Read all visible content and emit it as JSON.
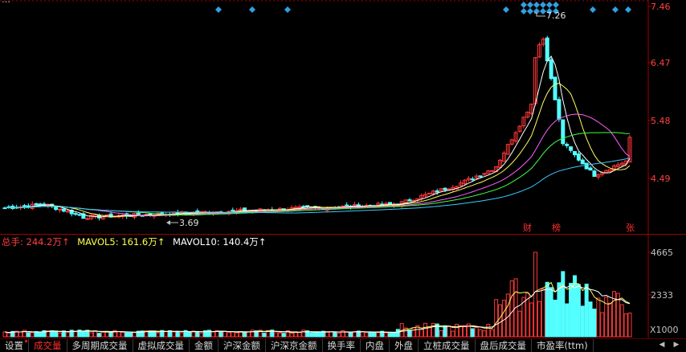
{
  "window": {
    "title_partial": "…"
  },
  "price_axis": {
    "labels": [
      "7.46",
      "6.47",
      "5.48",
      "4.49"
    ]
  },
  "volume_axis": {
    "labels": [
      "4665",
      "2333",
      "X1000"
    ]
  },
  "annotations": {
    "high_label": "7.26",
    "low_label": "3.69",
    "markers": [
      "财",
      "榜",
      "张"
    ]
  },
  "volume_header": {
    "total": "总手: 244.2万↑",
    "mavol5": "MAVOL5: 161.6万↑",
    "mavol10": "MAVOL10: 140.4万↑"
  },
  "tabs": [
    {
      "label": "设置",
      "dot": true
    },
    {
      "label": "成交量",
      "active": true
    },
    {
      "label": "多周期成交量"
    },
    {
      "label": "虚拟成交量"
    },
    {
      "label": "金额"
    },
    {
      "label": "沪深金额"
    },
    {
      "label": "沪深京金额"
    },
    {
      "label": "换手率"
    },
    {
      "label": "内盘"
    },
    {
      "label": "外盘"
    },
    {
      "label": "立桩成交量"
    },
    {
      "label": "盘后成交量"
    },
    {
      "label": "市盈率(ttm)"
    }
  ],
  "colors": {
    "up": "#ff3838",
    "down": "#54ffff",
    "axis": "#a00000",
    "ma_white": "#ffffff",
    "ma_yellow": "#ffff60",
    "ma_magenta": "#ff60ff",
    "ma_green": "#40ff40",
    "ma_cyan": "#40c8ff",
    "marker_blue": "#30a0e0"
  }
}
